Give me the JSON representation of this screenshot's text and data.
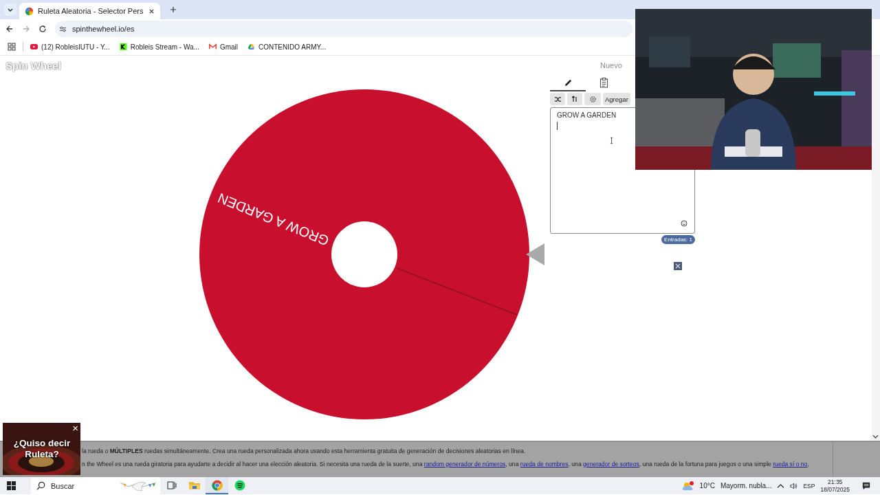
{
  "browser": {
    "tab": {
      "title": "Ruleta Aleatoria - Selector Pers",
      "selected": true
    },
    "url": "spinthewheel.io/es",
    "bookmarks": [
      {
        "label": "(12) RobleisIUTU - Y...",
        "kind": "youtube"
      },
      {
        "label": "Robleis Stream - Wa...",
        "kind": "kick"
      },
      {
        "label": "Gmail",
        "kind": "gmail"
      },
      {
        "label": "CONTENIDO ARMY...",
        "kind": "drive"
      }
    ]
  },
  "site": {
    "logo": "Spin Wheel",
    "new_button": "Nuevo"
  },
  "wheel": {
    "entries": [
      {
        "text": "GROW A GARDEN",
        "color": "#c8102e"
      }
    ]
  },
  "panel": {
    "tabs": [
      {
        "kind": "edit",
        "selected": true
      },
      {
        "kind": "results",
        "selected": false
      }
    ],
    "add_button": "Agregar",
    "entries_text": "GROW A GARDEN",
    "entries_badge": "Entradas: 1"
  },
  "info": {
    "line1": "la rueda o **MÚLTIPLES** ruedas simultáneamente. Crea una rueda personalizada ahora usando esta herramienta gratuita de generación de decisiones aleatorias en línea.",
    "line2": [
      {
        "text": "n the Wheel es una rueda giratoria para ayudarte a decidir al hacer una elección aleatoria. Si necesita una rueda de la suerte, una ",
        "link": false
      },
      {
        "text": "random generador de números",
        "link": true
      },
      {
        "text": ", una ",
        "link": false
      },
      {
        "text": "rueda de nombres",
        "link": true
      },
      {
        "text": ", una ",
        "link": false
      },
      {
        "text": "generador de sorteos",
        "link": true
      },
      {
        "text": ", una rueda de la fortuna para juegos o una simple ",
        "link": false
      },
      {
        "text": "rueda sí o no",
        "link": true
      },
      {
        "text": ",",
        "link": false
      }
    ]
  },
  "ad": {
    "text": "¿Quiso decir Ruleta?",
    "close": "×"
  },
  "taskbar": {
    "search_placeholder": "Buscar",
    "apps": [
      {
        "kind": "taskview",
        "active": false
      },
      {
        "kind": "folder",
        "active": false
      },
      {
        "kind": "chrome",
        "active": true
      },
      {
        "kind": "spotify",
        "active": false
      }
    ],
    "temperature": "10°C",
    "weather": "Mayorm. nubla...",
    "language": "ESP",
    "time": "21:35",
    "date": "18/07/2025"
  }
}
